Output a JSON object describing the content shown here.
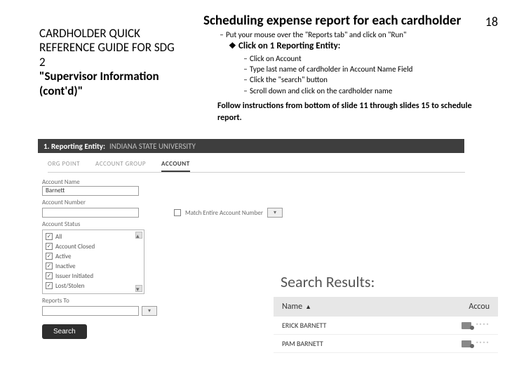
{
  "page_number": "18",
  "left_panel": {
    "line1": "CARDHOLDER QUICK REFERENCE GUIDE FOR SDG 2",
    "bold": "\"Supervisor Information (cont'd)\""
  },
  "main": {
    "title": "Scheduling expense report for each cardholder",
    "bullet_top": "Put your mouse over the \"Reports tab\" and click on \"Run\"",
    "bullet_section": "Click on 1 Reporting Entity:",
    "subs": {
      "s0": "Click on Account",
      "s1": "Type last name of cardholder in Account Name Field",
      "s2": "Click the \"search\" button",
      "s3": "Scroll down and click on the cardholder name"
    },
    "follow": "Follow instructions from bottom of slide 11 through slides 15 to schedule report."
  },
  "entity_bar": {
    "label": "1. Reporting Entity:",
    "value": "INDIANA STATE UNIVERSITY"
  },
  "tabs": {
    "t0": "ORG POINT",
    "t1": "ACCOUNT GROUP",
    "t2": "ACCOUNT"
  },
  "form": {
    "account_name_label": "Account Name",
    "account_name_value": "Barnett",
    "account_number_label": "Account Number",
    "match_label": "Match Entire Account Number",
    "status_label": "Account Status",
    "status": {
      "s0": "All",
      "s1": "Account Closed",
      "s2": "Active",
      "s3": "Inactive",
      "s4": "Issuer Initiated",
      "s5": "Lost/Stolen"
    },
    "reports_to_label": "Reports To",
    "search_btn": "Search"
  },
  "results": {
    "title": "Search Results:",
    "col_name": "Name",
    "col_account": "Accou",
    "rows": {
      "r0": {
        "name": "ERICK BARNETT"
      },
      "r1": {
        "name": "PAM BARNETT"
      }
    }
  }
}
